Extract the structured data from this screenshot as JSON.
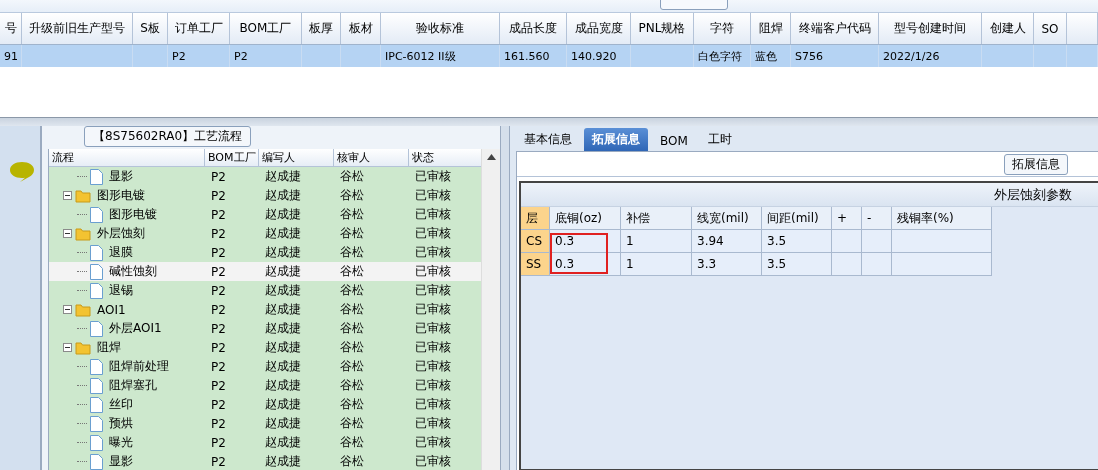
{
  "product_table": {
    "columns": [
      "号",
      "升级前旧生产型号",
      "S板",
      "订单工厂",
      "BOM工厂",
      "板厚",
      "板材",
      "验收标准",
      "成品长度",
      "成品宽度",
      "PNL规格",
      "字符",
      "阻焊",
      "终端客户代码",
      "型号创建时间",
      "创建人",
      "SO"
    ],
    "rows": [
      {
        "selected": true,
        "cells": [
          "91",
          "",
          "",
          "P2",
          "P2",
          "",
          "",
          "IPC-6012 II级",
          "161.560",
          "140.920",
          "",
          "白色字符",
          "蓝色",
          "S756",
          "2022/1/26",
          "",
          ""
        ]
      }
    ]
  },
  "process_panel": {
    "title": "【8S75602RA0】工艺流程",
    "columns": [
      "流程",
      "BOM工厂",
      "编写人",
      "核审人",
      "状态"
    ],
    "tree": [
      {
        "children": [
          {
            "name": "显影",
            "factory": "P2",
            "writer": "赵成捷",
            "reviewer": "谷松",
            "status": "已审核",
            "selected": false
          }
        ]
      },
      {
        "name": "图形电镀",
        "factory": "P2",
        "writer": "赵成捷",
        "reviewer": "谷松",
        "status": "已审核",
        "selected": false,
        "expanded": true,
        "children": [
          {
            "name": "图形电镀",
            "factory": "P2",
            "writer": "赵成捷",
            "reviewer": "谷松",
            "status": "已审核",
            "selected": false
          }
        ]
      },
      {
        "name": "外层蚀刻",
        "factory": "P2",
        "writer": "赵成捷",
        "reviewer": "谷松",
        "status": "已审核",
        "selected": false,
        "expanded": true,
        "children": [
          {
            "name": "退膜",
            "factory": "P2",
            "writer": "赵成捷",
            "reviewer": "谷松",
            "status": "已审核",
            "selected": false
          },
          {
            "name": "碱性蚀刻",
            "factory": "P2",
            "writer": "赵成捷",
            "reviewer": "谷松",
            "status": "已审核",
            "selected": true
          },
          {
            "name": "退锡",
            "factory": "P2",
            "writer": "赵成捷",
            "reviewer": "谷松",
            "status": "已审核",
            "selected": false
          }
        ]
      },
      {
        "name": "AOI1",
        "factory": "P2",
        "writer": "赵成捷",
        "reviewer": "谷松",
        "status": "已审核",
        "selected": false,
        "expanded": true,
        "children": [
          {
            "name": "外层AOI1",
            "factory": "P2",
            "writer": "赵成捷",
            "reviewer": "谷松",
            "status": "已审核",
            "selected": false
          }
        ]
      },
      {
        "name": "阻焊",
        "factory": "P2",
        "writer": "赵成捷",
        "reviewer": "谷松",
        "status": "已审核",
        "selected": false,
        "expanded": true,
        "children": [
          {
            "name": "阻焊前处理",
            "factory": "P2",
            "writer": "赵成捷",
            "reviewer": "谷松",
            "status": "已审核",
            "selected": false
          },
          {
            "name": "阻焊塞孔",
            "factory": "P2",
            "writer": "赵成捷",
            "reviewer": "谷松",
            "status": "已审核",
            "selected": false
          },
          {
            "name": "丝印",
            "factory": "P2",
            "writer": "赵成捷",
            "reviewer": "谷松",
            "status": "已审核",
            "selected": false
          },
          {
            "name": "预烘",
            "factory": "P2",
            "writer": "赵成捷",
            "reviewer": "谷松",
            "status": "已审核",
            "selected": false
          },
          {
            "name": "曝光",
            "factory": "P2",
            "writer": "赵成捷",
            "reviewer": "谷松",
            "status": "已审核",
            "selected": false
          },
          {
            "name": "显影",
            "factory": "P2",
            "writer": "赵成捷",
            "reviewer": "谷松",
            "status": "已审核",
            "selected": false
          }
        ]
      }
    ]
  },
  "detail_tabs": [
    {
      "label": "基本信息",
      "selected": false
    },
    {
      "label": "拓展信息",
      "selected": true
    },
    {
      "label": "BOM",
      "selected": false
    },
    {
      "label": "工时",
      "selected": false
    }
  ],
  "extended_info": {
    "group_title": "拓展信息",
    "table_title": "外层蚀刻参数",
    "columns": [
      "层",
      "底铜(oz)",
      "补偿",
      "线宽(mil)",
      "间距(mil)",
      "+",
      "-",
      "残铜率(%)"
    ],
    "rows": [
      {
        "cells": [
          {
            "text": "CS",
            "highlighted": false
          },
          {
            "text": "0.3",
            "highlighted": true
          },
          {
            "text": "1",
            "highlighted": false
          },
          {
            "text": "3.94",
            "highlighted": false
          },
          {
            "text": "3.5",
            "highlighted": false
          },
          {
            "text": "",
            "highlighted": false
          },
          {
            "text": "",
            "highlighted": false
          },
          {
            "text": "",
            "highlighted": false
          }
        ]
      },
      {
        "cells": [
          {
            "text": "SS",
            "highlighted": false
          },
          {
            "text": "0.3",
            "highlighted": true
          },
          {
            "text": "1",
            "highlighted": false
          },
          {
            "text": "3.3",
            "highlighted": false
          },
          {
            "text": "3.5",
            "highlighted": false
          },
          {
            "text": "",
            "highlighted": false
          },
          {
            "text": "",
            "highlighted": false
          },
          {
            "text": "",
            "highlighted": false
          }
        ]
      }
    ]
  }
}
